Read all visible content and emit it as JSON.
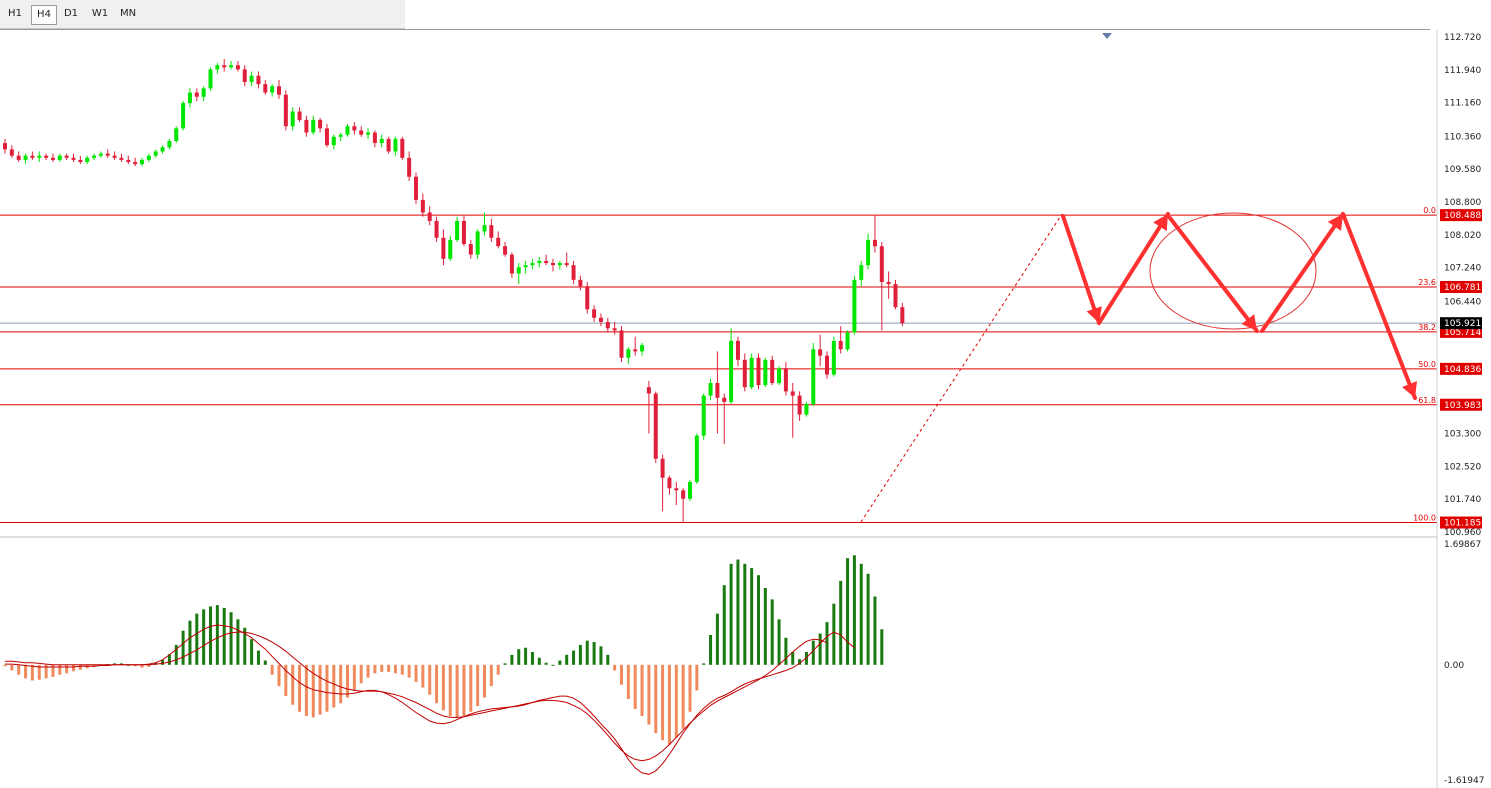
{
  "toolbar": {
    "timeframes": [
      "H1",
      "H4",
      "D1",
      "W1",
      "MN"
    ],
    "active": "H4"
  },
  "colors": {
    "bull": "#00e600",
    "bear": "#e0203a",
    "fib_line": "#e00000",
    "price_label_bg": "#e00000",
    "current_label_bg": "#000000",
    "macd_up": "#1a7a12",
    "macd_down": "#f08a5d",
    "macd_line": "#c00000",
    "arrow": "#ff3030"
  },
  "chart_data": [
    {
      "type": "candlestick",
      "name": "price",
      "ylim": [
        100.96,
        112.72
      ],
      "y_ticks": [
        "112.720",
        "111.940",
        "111.160",
        "110.360",
        "109.580",
        "108.800",
        "108.020",
        "107.240",
        "106.440",
        "103.300",
        "102.520",
        "101.740",
        "100.960"
      ],
      "current_price": "105.921",
      "fib_levels": [
        {
          "pct": "0.0",
          "price": "108.488"
        },
        {
          "pct": "23.6",
          "price": "106.781"
        },
        {
          "pct": "38.2",
          "price": "105.714"
        },
        {
          "pct": "50.0",
          "price": "104.836"
        },
        {
          "pct": "61.8",
          "price": "103.983"
        },
        {
          "pct": "100.0",
          "price": "101.185"
        }
      ],
      "ohlc": [
        [
          110.2,
          110.3,
          109.95,
          110.05
        ],
        [
          110.05,
          110.15,
          109.85,
          109.9
        ],
        [
          109.9,
          110.0,
          109.75,
          109.8
        ],
        [
          109.8,
          109.95,
          109.7,
          109.9
        ],
        [
          109.9,
          110.0,
          109.8,
          109.85
        ],
        [
          109.85,
          110.0,
          109.75,
          109.9
        ],
        [
          109.9,
          109.95,
          109.8,
          109.85
        ],
        [
          109.85,
          109.95,
          109.75,
          109.8
        ],
        [
          109.8,
          109.95,
          109.75,
          109.9
        ],
        [
          109.9,
          109.95,
          109.8,
          109.85
        ],
        [
          109.85,
          109.95,
          109.75,
          109.8
        ],
        [
          109.8,
          109.9,
          109.7,
          109.75
        ],
        [
          109.75,
          109.9,
          109.7,
          109.85
        ],
        [
          109.85,
          109.95,
          109.8,
          109.9
        ],
        [
          109.9,
          110.0,
          109.85,
          109.95
        ],
        [
          109.95,
          110.05,
          109.85,
          109.9
        ],
        [
          109.9,
          110.0,
          109.8,
          109.85
        ],
        [
          109.85,
          109.95,
          109.75,
          109.8
        ],
        [
          109.8,
          109.9,
          109.7,
          109.75
        ],
        [
          109.75,
          109.85,
          109.65,
          109.7
        ],
        [
          109.7,
          109.85,
          109.65,
          109.8
        ],
        [
          109.8,
          109.95,
          109.75,
          109.9
        ],
        [
          109.9,
          110.05,
          109.85,
          110.0
        ],
        [
          110.0,
          110.15,
          109.95,
          110.1
        ],
        [
          110.1,
          110.3,
          110.05,
          110.25
        ],
        [
          110.25,
          110.6,
          110.2,
          110.55
        ],
        [
          110.55,
          111.2,
          110.5,
          111.15
        ],
        [
          111.15,
          111.5,
          111.05,
          111.4
        ],
        [
          111.4,
          111.5,
          111.2,
          111.3
        ],
        [
          111.3,
          111.55,
          111.2,
          111.5
        ],
        [
          111.5,
          112.0,
          111.45,
          111.95
        ],
        [
          111.95,
          112.1,
          111.85,
          112.05
        ],
        [
          112.05,
          112.2,
          111.9,
          112.0
        ],
        [
          112.0,
          112.15,
          111.95,
          112.05
        ],
        [
          112.05,
          112.15,
          111.9,
          111.95
        ],
        [
          111.95,
          112.05,
          111.55,
          111.65
        ],
        [
          111.65,
          111.9,
          111.55,
          111.8
        ],
        [
          111.8,
          111.9,
          111.5,
          111.6
        ],
        [
          111.6,
          111.7,
          111.35,
          111.4
        ],
        [
          111.4,
          111.6,
          111.3,
          111.55
        ],
        [
          111.55,
          111.7,
          111.25,
          111.35
        ],
        [
          111.35,
          111.45,
          110.5,
          110.6
        ],
        [
          110.6,
          111.05,
          110.5,
          110.95
        ],
        [
          110.95,
          111.05,
          110.7,
          110.75
        ],
        [
          110.75,
          110.85,
          110.35,
          110.45
        ],
        [
          110.45,
          110.85,
          110.4,
          110.75
        ],
        [
          110.75,
          110.8,
          110.45,
          110.55
        ],
        [
          110.55,
          110.65,
          110.1,
          110.15
        ],
        [
          110.15,
          110.4,
          110.05,
          110.35
        ],
        [
          110.35,
          110.45,
          110.25,
          110.4
        ],
        [
          110.4,
          110.65,
          110.35,
          110.6
        ],
        [
          110.6,
          110.7,
          110.4,
          110.5
        ],
        [
          110.5,
          110.6,
          110.35,
          110.4
        ],
        [
          110.4,
          110.55,
          110.3,
          110.45
        ],
        [
          110.45,
          110.5,
          110.1,
          110.2
        ],
        [
          110.2,
          110.4,
          110.1,
          110.3
        ],
        [
          110.3,
          110.35,
          109.95,
          110.0
        ],
        [
          110.0,
          110.35,
          109.9,
          110.3
        ],
        [
          110.3,
          110.35,
          109.8,
          109.85
        ],
        [
          109.85,
          110.0,
          109.3,
          109.4
        ],
        [
          109.4,
          109.5,
          108.75,
          108.85
        ],
        [
          108.85,
          109.0,
          108.45,
          108.55
        ],
        [
          108.55,
          108.7,
          108.25,
          108.35
        ],
        [
          108.35,
          108.45,
          107.85,
          107.95
        ],
        [
          107.95,
          108.15,
          107.3,
          107.45
        ],
        [
          107.45,
          108.0,
          107.4,
          107.9
        ],
        [
          107.9,
          108.45,
          107.85,
          108.35
        ],
        [
          108.35,
          108.5,
          107.75,
          107.8
        ],
        [
          107.8,
          107.9,
          107.45,
          107.55
        ],
        [
          107.55,
          108.15,
          107.45,
          108.1
        ],
        [
          108.1,
          108.55,
          108.0,
          108.25
        ],
        [
          108.25,
          108.4,
          107.85,
          107.95
        ],
        [
          107.95,
          108.1,
          107.7,
          107.75
        ],
        [
          107.75,
          107.85,
          107.5,
          107.55
        ],
        [
          107.55,
          107.6,
          107.0,
          107.1
        ],
        [
          107.1,
          107.35,
          106.85,
          107.25
        ],
        [
          107.25,
          107.4,
          107.1,
          107.3
        ],
        [
          107.3,
          107.45,
          107.2,
          107.35
        ],
        [
          107.35,
          107.5,
          107.25,
          107.4
        ],
        [
          107.4,
          107.55,
          107.3,
          107.35
        ],
        [
          107.35,
          107.45,
          107.15,
          107.3
        ],
        [
          107.3,
          107.4,
          107.2,
          107.35
        ],
        [
          107.35,
          107.6,
          107.25,
          107.3
        ],
        [
          107.3,
          107.4,
          106.85,
          106.95
        ],
        [
          106.95,
          107.05,
          106.7,
          106.8
        ],
        [
          106.8,
          106.9,
          106.15,
          106.25
        ],
        [
          106.25,
          106.35,
          105.95,
          106.05
        ],
        [
          106.05,
          106.15,
          105.85,
          105.95
        ],
        [
          105.95,
          106.05,
          105.7,
          105.8
        ],
        [
          105.8,
          105.95,
          105.65,
          105.75
        ],
        [
          105.75,
          105.85,
          105.0,
          105.1
        ],
        [
          105.1,
          105.35,
          104.95,
          105.3
        ],
        [
          105.3,
          105.6,
          105.15,
          105.25
        ],
        [
          105.25,
          105.45,
          105.15,
          105.4
        ],
        [
          104.4,
          104.55,
          103.3,
          104.25
        ],
        [
          104.25,
          104.3,
          102.6,
          102.7
        ],
        [
          102.7,
          102.8,
          101.45,
          102.25
        ],
        [
          102.25,
          102.3,
          101.85,
          102.0
        ],
        [
          102.0,
          102.15,
          101.6,
          101.95
        ],
        [
          101.95,
          102.0,
          101.2,
          101.75
        ],
        [
          101.75,
          102.2,
          101.7,
          102.15
        ],
        [
          102.15,
          103.3,
          102.1,
          103.25
        ],
        [
          103.25,
          104.25,
          103.15,
          104.2
        ],
        [
          104.2,
          104.6,
          104.1,
          104.5
        ],
        [
          104.5,
          105.25,
          103.3,
          104.15
        ],
        [
          104.15,
          104.25,
          103.05,
          104.05
        ],
        [
          104.05,
          105.8,
          104.0,
          105.5
        ],
        [
          105.5,
          105.6,
          104.9,
          105.05
        ],
        [
          105.05,
          105.2,
          104.3,
          104.4
        ],
        [
          104.4,
          105.2,
          104.35,
          105.1
        ],
        [
          105.1,
          105.2,
          104.35,
          104.45
        ],
        [
          104.45,
          105.1,
          104.4,
          105.05
        ],
        [
          105.05,
          105.15,
          104.45,
          104.5
        ],
        [
          104.5,
          104.9,
          104.45,
          104.85
        ],
        [
          104.85,
          105.0,
          104.2,
          104.3
        ],
        [
          104.3,
          104.5,
          103.2,
          104.2
        ],
        [
          104.2,
          104.3,
          103.6,
          103.75
        ],
        [
          103.75,
          104.05,
          103.7,
          104.0
        ],
        [
          104.0,
          105.45,
          103.95,
          105.3
        ],
        [
          105.3,
          105.65,
          104.9,
          105.15
        ],
        [
          105.15,
          105.25,
          104.6,
          104.7
        ],
        [
          104.7,
          105.6,
          104.65,
          105.5
        ],
        [
          105.5,
          105.85,
          105.2,
          105.3
        ],
        [
          105.3,
          105.75,
          105.25,
          105.7
        ],
        [
          105.7,
          107.05,
          105.65,
          106.95
        ],
        [
          106.95,
          107.4,
          106.8,
          107.3
        ],
        [
          107.3,
          108.05,
          107.2,
          107.9
        ],
        [
          107.9,
          108.49,
          107.6,
          107.75
        ],
        [
          107.75,
          107.85,
          105.75,
          106.9
        ],
        [
          106.9,
          107.15,
          106.5,
          106.85
        ],
        [
          106.85,
          106.95,
          106.25,
          106.3
        ],
        [
          106.3,
          106.4,
          105.85,
          105.92
        ]
      ]
    },
    {
      "type": "histogram+lines",
      "name": "MACD",
      "ylim": [
        -1.61947,
        1.69867
      ],
      "y_ticks": [
        "1.69867",
        "0.00",
        "-1.61947"
      ],
      "histogram": [
        -0.02,
        -0.08,
        -0.14,
        -0.19,
        -0.22,
        -0.21,
        -0.19,
        -0.17,
        -0.14,
        -0.12,
        -0.09,
        -0.07,
        -0.05,
        -0.03,
        -0.01,
        0.01,
        0.02,
        0.02,
        0.0,
        -0.02,
        -0.04,
        -0.03,
        0.03,
        0.07,
        0.15,
        0.28,
        0.48,
        0.62,
        0.72,
        0.78,
        0.82,
        0.84,
        0.8,
        0.74,
        0.64,
        0.52,
        0.36,
        0.2,
        0.06,
        -0.14,
        -0.3,
        -0.44,
        -0.56,
        -0.66,
        -0.72,
        -0.74,
        -0.7,
        -0.66,
        -0.6,
        -0.54,
        -0.46,
        -0.36,
        -0.26,
        -0.18,
        -0.12,
        -0.1,
        -0.1,
        -0.12,
        -0.14,
        -0.18,
        -0.24,
        -0.32,
        -0.42,
        -0.54,
        -0.64,
        -0.72,
        -0.74,
        -0.72,
        -0.66,
        -0.58,
        -0.46,
        -0.3,
        -0.14,
        0.02,
        0.14,
        0.22,
        0.24,
        0.18,
        0.1,
        0.03,
        0.0,
        0.06,
        0.14,
        0.2,
        0.28,
        0.34,
        0.32,
        0.26,
        0.14,
        -0.08,
        -0.28,
        -0.48,
        -0.62,
        -0.72,
        -0.84,
        -0.96,
        -1.06,
        -1.12,
        -1.02,
        -0.9,
        -0.66,
        -0.36,
        0.02,
        0.42,
        0.72,
        1.12,
        1.42,
        1.48,
        1.42,
        1.36,
        1.26,
        1.08,
        0.92,
        0.64,
        0.38,
        0.18,
        0.08,
        0.18,
        0.34,
        0.44,
        0.6,
        0.86,
        1.18,
        1.5,
        1.54,
        1.42,
        1.28,
        0.96,
        0.5
      ],
      "macd_line": [
        0.01,
        0.01,
        0.0,
        -0.01,
        -0.02,
        -0.03,
        -0.03,
        -0.03,
        -0.03,
        -0.03,
        -0.03,
        -0.02,
        -0.02,
        -0.02,
        -0.01,
        -0.01,
        0.0,
        0.0,
        0.0,
        0.0,
        0.0,
        0.01,
        0.03,
        0.07,
        0.14,
        0.22,
        0.3,
        0.38,
        0.44,
        0.5,
        0.54,
        0.56,
        0.55,
        0.53,
        0.49,
        0.44,
        0.38,
        0.3,
        0.22,
        0.12,
        0.02,
        -0.08,
        -0.17,
        -0.25,
        -0.31,
        -0.35,
        -0.37,
        -0.39,
        -0.4,
        -0.41,
        -0.41,
        -0.4,
        -0.38,
        -0.36,
        -0.36,
        -0.38,
        -0.42,
        -0.47,
        -0.53,
        -0.6,
        -0.67,
        -0.73,
        -0.79,
        -0.82,
        -0.83,
        -0.81,
        -0.77,
        -0.73,
        -0.69,
        -0.66,
        -0.64,
        -0.62,
        -0.61,
        -0.6,
        -0.59,
        -0.58,
        -0.56,
        -0.53,
        -0.5,
        -0.48,
        -0.46,
        -0.44,
        -0.44,
        -0.47,
        -0.53,
        -0.62,
        -0.72,
        -0.83,
        -0.93,
        -1.04,
        -1.18,
        -1.33,
        -1.45,
        -1.52,
        -1.54,
        -1.49,
        -1.39,
        -1.26,
        -1.11,
        -0.96,
        -0.83,
        -0.71,
        -0.61,
        -0.53,
        -0.47,
        -0.43,
        -0.38,
        -0.32,
        -0.27,
        -0.23,
        -0.2,
        -0.17,
        -0.14,
        -0.11,
        -0.08,
        -0.04,
        0.02,
        0.1,
        0.2,
        0.3,
        0.4,
        0.46,
        0.42,
        0.32,
        0.24
      ],
      "signal_line": [
        0.05,
        0.05,
        0.04,
        0.03,
        0.03,
        0.02,
        0.01,
        0.0,
        0.0,
        0.0,
        0.0,
        0.0,
        0.0,
        0.0,
        0.0,
        0.0,
        0.0,
        0.0,
        0.0,
        0.0,
        0.0,
        0.0,
        0.01,
        0.02,
        0.04,
        0.07,
        0.11,
        0.16,
        0.21,
        0.27,
        0.33,
        0.38,
        0.42,
        0.45,
        0.46,
        0.46,
        0.44,
        0.41,
        0.37,
        0.32,
        0.26,
        0.19,
        0.11,
        0.03,
        -0.05,
        -0.12,
        -0.18,
        -0.23,
        -0.27,
        -0.31,
        -0.34,
        -0.36,
        -0.37,
        -0.37,
        -0.37,
        -0.38,
        -0.4,
        -0.42,
        -0.45,
        -0.49,
        -0.53,
        -0.58,
        -0.63,
        -0.68,
        -0.72,
        -0.74,
        -0.74,
        -0.73,
        -0.71,
        -0.69,
        -0.67,
        -0.65,
        -0.63,
        -0.61,
        -0.59,
        -0.57,
        -0.55,
        -0.53,
        -0.51,
        -0.5,
        -0.5,
        -0.51,
        -0.53,
        -0.57,
        -0.62,
        -0.69,
        -0.78,
        -0.88,
        -0.99,
        -1.1,
        -1.2,
        -1.28,
        -1.33,
        -1.35,
        -1.33,
        -1.28,
        -1.21,
        -1.12,
        -1.02,
        -0.92,
        -0.82,
        -0.73,
        -0.65,
        -0.57,
        -0.51,
        -0.46,
        -0.41,
        -0.36,
        -0.31,
        -0.26,
        -0.21,
        -0.15,
        -0.08,
        0.0,
        0.09,
        0.18,
        0.26,
        0.33,
        0.36,
        0.35,
        0.31
      ]
    }
  ]
}
